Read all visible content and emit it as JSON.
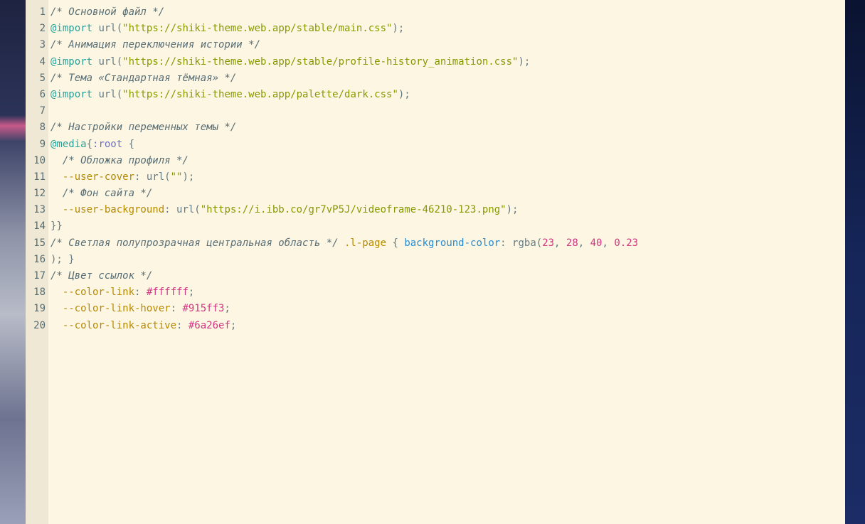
{
  "editor": {
    "line_numbers": [
      "1",
      "2",
      "3",
      "4",
      "5",
      "6",
      "7",
      "8",
      "9",
      "10",
      "11",
      "12",
      "13",
      "14",
      "15",
      "16",
      "17",
      "18",
      "19",
      "20"
    ],
    "l1": {
      "comment": "/* Основной файл */"
    },
    "l2": {
      "at": "@import",
      "fn": " url(",
      "str": "\"https://shiki-theme.web.app/stable/main.css\"",
      "end": ");"
    },
    "l3": {
      "comment": "/* Анимация переключения истории */"
    },
    "l4": {
      "at": "@import",
      "fn": " url(",
      "str": "\"https://shiki-theme.web.app/stable/profile-history_animation.css\"",
      "end": ");"
    },
    "l5": {
      "comment": "/* Тема «Стандартная тёмная» */"
    },
    "l6": {
      "at": "@import",
      "fn": " url(",
      "str": "\"https://shiki-theme.web.app/palette/dark.css\"",
      "end": ");"
    },
    "l7": {
      "text": ""
    },
    "l8": {
      "comment": "/* Настройки переменных темы */"
    },
    "l9": {
      "at": "@media",
      "p1": "{",
      "kw": ":root",
      "p2": " {"
    },
    "l10": {
      "indent": "  ",
      "comment": "/* Обложка профиля */"
    },
    "l11": {
      "indent": "  ",
      "var": "--user-cover",
      "p": ": ",
      "fn": "url(",
      "str": "\"\"",
      "end": ");"
    },
    "l12": {
      "indent": "  ",
      "comment": "/* Фон сайта */"
    },
    "l13": {
      "indent": "  ",
      "var": "--user-background",
      "p": ": ",
      "fn": "url(",
      "str": "\"https://i.ibb.co/gr7vP5J/videoframe-46210-123.png\"",
      "end": ");"
    },
    "l14": {
      "text": "}}"
    },
    "l15": {
      "comment": "/* Светлая полупрозрачная центральная область */",
      "sel": " .l-page",
      "p1": " { ",
      "prop": "background-color",
      "p2": ": ",
      "fn": "rgba(",
      "n1": "23",
      "c1": ", ",
      "n2": "28",
      "c2": ", ",
      "n3": "40",
      "c3": ", ",
      "n4": "0.23"
    },
    "l16": {
      "text": "); }"
    },
    "l17": {
      "comment": "/* Цвет ссылок */"
    },
    "l18": {
      "indent": "  ",
      "var": "--color-link",
      "p": ": ",
      "hex": "#ffffff",
      "end": ";"
    },
    "l19": {
      "indent": "  ",
      "var": "--color-link-hover",
      "p": ": ",
      "hex": "#915ff3",
      "end": ";"
    },
    "l20": {
      "indent": "  ",
      "var": "--color-link-active",
      "p": ": ",
      "hex": "#6a26ef",
      "end": ";"
    }
  },
  "colors": {
    "editor_bg": "#fdf6e3",
    "gutter_bg": "#eee8d5",
    "comment": "#586e75",
    "string": "#859900",
    "at_rule": "#2aa198",
    "variable": "#b58900",
    "number": "#d33682"
  }
}
